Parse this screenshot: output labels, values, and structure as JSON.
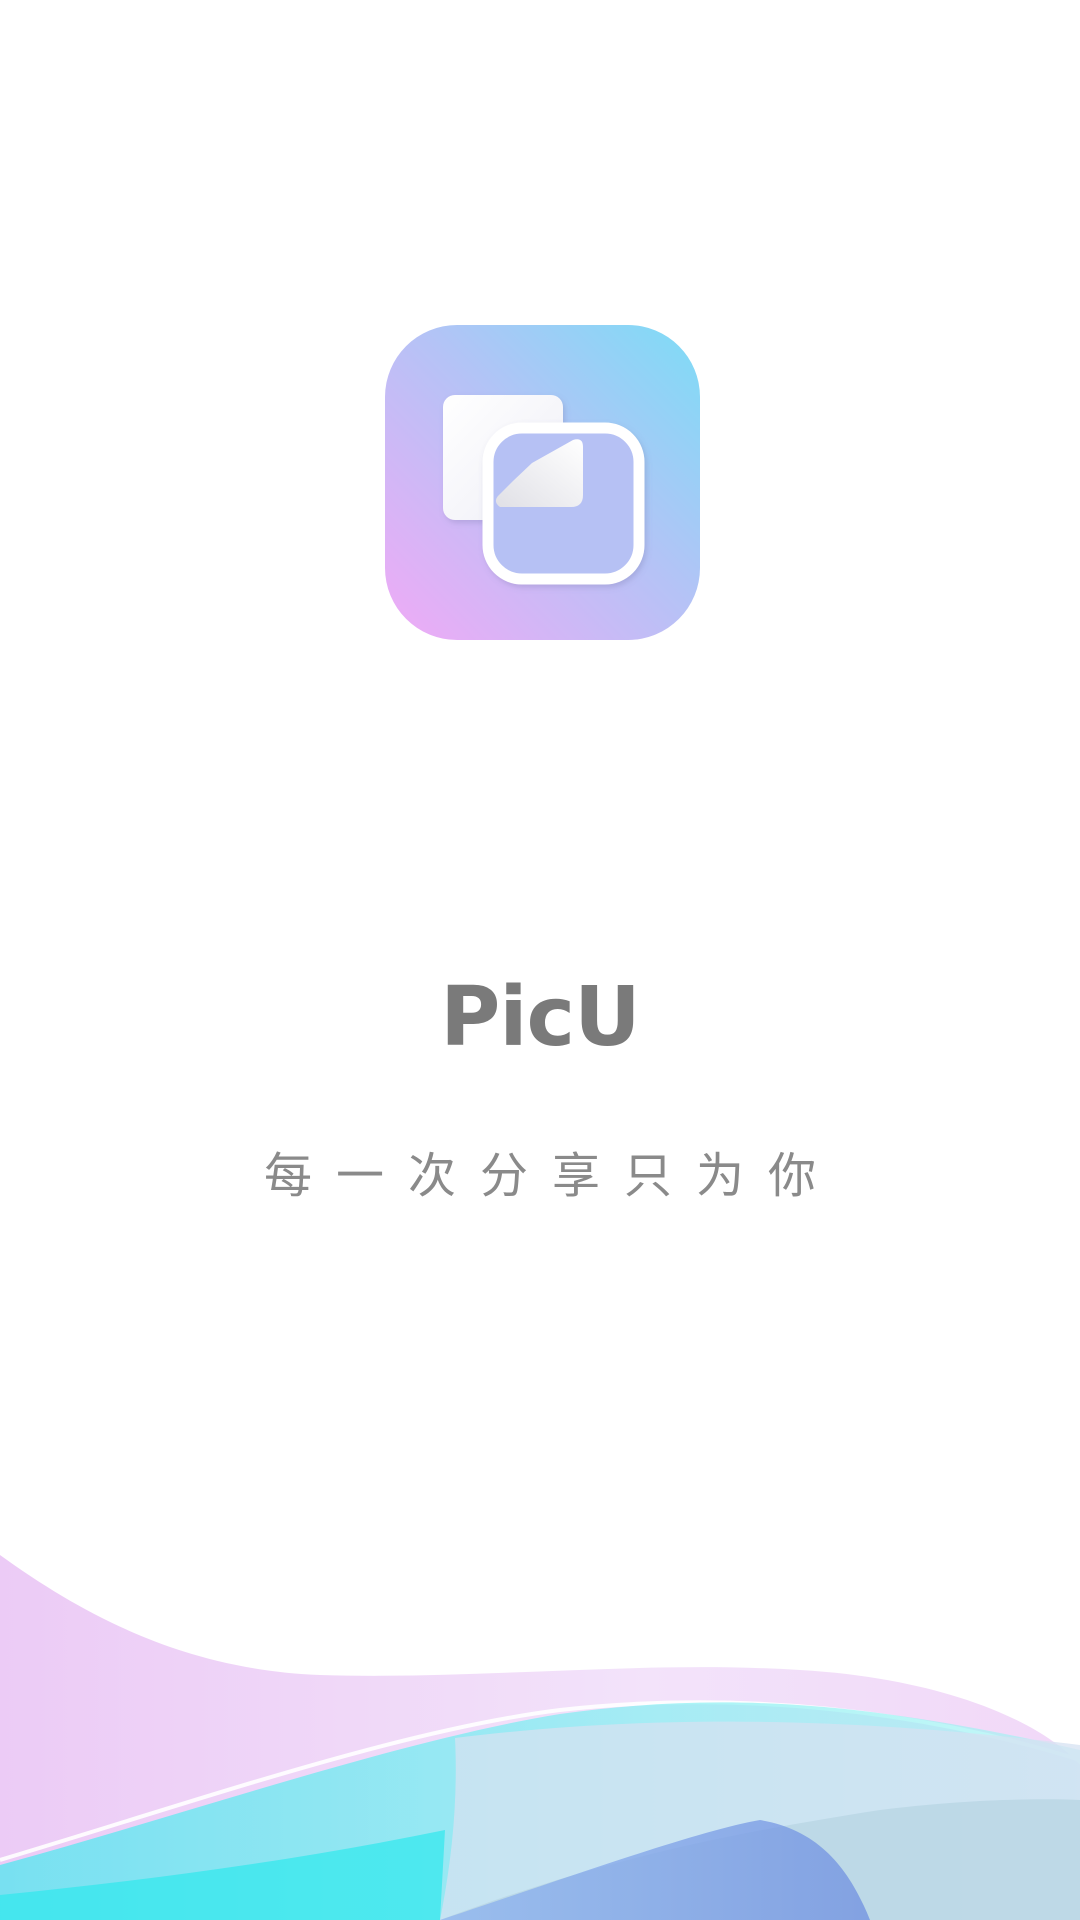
{
  "app": {
    "name": "PicU",
    "tagline": "每一次分享只为你"
  },
  "icons": {
    "app_logo": "picu-app-icon"
  },
  "colors": {
    "background": "#ffffff",
    "title_text": "#7a7a7a",
    "tagline_text": "#8a8a8a",
    "icon_gradient_start": "#ecaef6",
    "icon_gradient_end": "#7fdcf5",
    "wave_pink": "#efd5f7",
    "wave_cyan": "#5ef0f0",
    "wave_blue": "#7fa3e3"
  }
}
